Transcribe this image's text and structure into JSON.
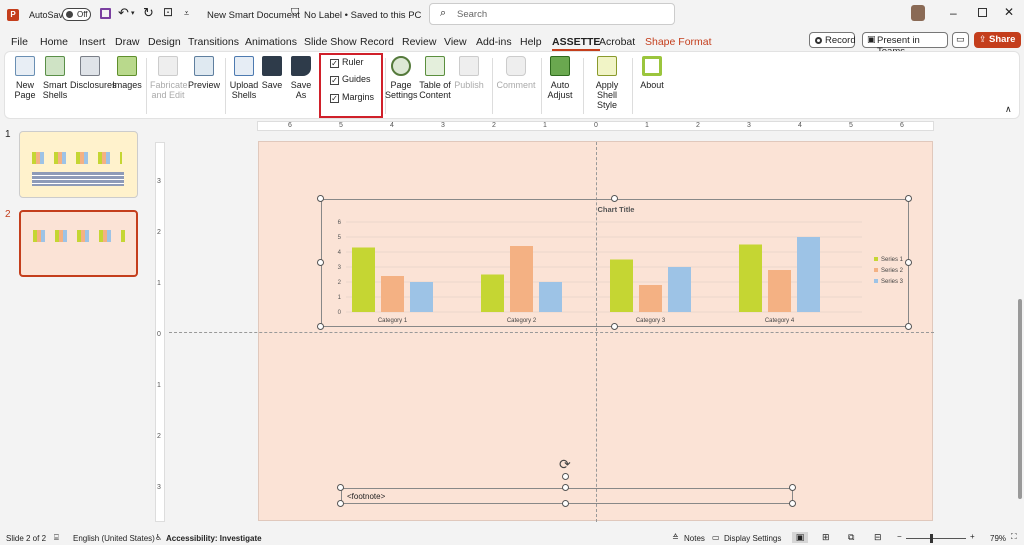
{
  "titlebar": {
    "autosave_label": "AutoSave",
    "autosave_state": "Off",
    "doc_title": "New Smart Document",
    "label_status": "No Label • Saved to this PC",
    "search_placeholder": "Search"
  },
  "tabs": [
    "File",
    "Home",
    "Insert",
    "Draw",
    "Design",
    "Transitions",
    "Animations",
    "Slide Show",
    "Record",
    "Review",
    "View",
    "Add-ins",
    "Help",
    "ASSETTE",
    "Acrobat",
    "Shape Format"
  ],
  "actions": {
    "record": "Record",
    "present": "Present in Teams",
    "share": "Share"
  },
  "ribbon": {
    "new_page": "New Page",
    "smart_shells": "Smart Shells",
    "disclosures": "Disclosures",
    "images": "Images",
    "fabricate": "Fabricate and Edit",
    "preview": "Preview",
    "upload_shells": "Upload Shells",
    "save": "Save",
    "save_as": "Save As",
    "ruler": "Ruler",
    "guides": "Guides",
    "margins": "Margins",
    "page_settings": "Page Settings",
    "table_of_content": "Table of Content",
    "publish": "Publish",
    "comment": "Comment",
    "auto_adjust": "Auto Adjust",
    "apply_shell_style": "Apply Shell Style",
    "about": "About"
  },
  "slides": {
    "num1": "1",
    "num2": "2"
  },
  "ruler_h": [
    "6",
    "5",
    "4",
    "3",
    "2",
    "1",
    "0",
    "1",
    "2",
    "3",
    "4",
    "5",
    "6"
  ],
  "ruler_v": [
    "3",
    "2",
    "1",
    "0",
    "1",
    "2",
    "3"
  ],
  "footnote": "<footnote>",
  "status": {
    "slide": "Slide 2 of 2",
    "language": "English (United States)",
    "accessibility": "Accessibility: Investigate",
    "notes": "Notes",
    "display": "Display Settings",
    "zoom": "79%"
  },
  "colors": {
    "accent": "#c43e1c",
    "slide_bg": "#fbe3d6",
    "series1": "#c5d633",
    "series2": "#f4b183",
    "series3": "#9dc3e6"
  },
  "chart_data": {
    "type": "bar",
    "title": "Chart Title",
    "categories": [
      "Category 1",
      "Category 2",
      "Category 3",
      "Category 4"
    ],
    "series": [
      {
        "name": "Series 1",
        "values": [
          4.3,
          2.5,
          3.5,
          4.5
        ]
      },
      {
        "name": "Series 2",
        "values": [
          2.4,
          4.4,
          1.8,
          2.8
        ]
      },
      {
        "name": "Series 3",
        "values": [
          2,
          2,
          3,
          5
        ]
      }
    ],
    "ylim": [
      0,
      6
    ],
    "yticks": [
      "0",
      "1",
      "2",
      "3",
      "4",
      "5",
      "6"
    ],
    "grid": true,
    "legend": "right"
  }
}
